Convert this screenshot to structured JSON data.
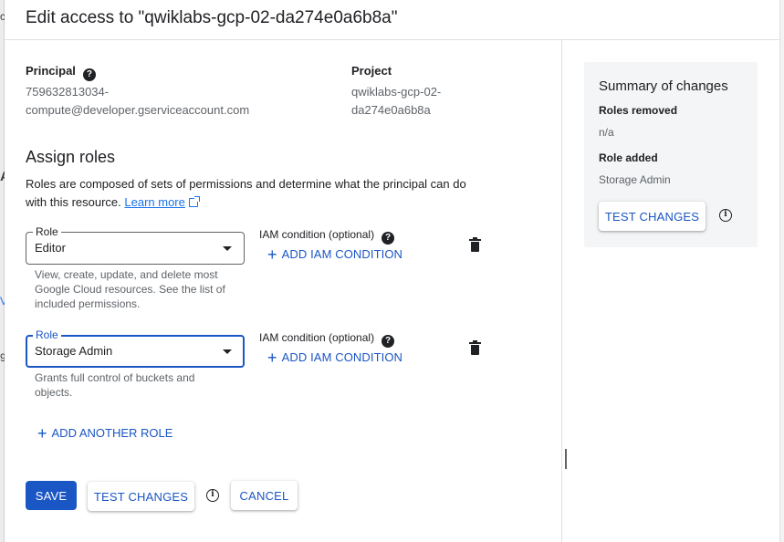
{
  "background": {
    "fragments": [
      "c",
      "A",
      "V",
      "9"
    ]
  },
  "header": {
    "title": "Edit access to \"qwiklabs-gcp-02-da274e0a6b8a\""
  },
  "principal": {
    "label": "Principal",
    "value_line1": "759632813034-",
    "value_line2": "compute@developer.gserviceaccount.com"
  },
  "project": {
    "label": "Project",
    "value_line1": "qwiklabs-gcp-02-",
    "value_line2": "da274e0a6b8a"
  },
  "assign_roles": {
    "title": "Assign roles",
    "description": "Roles are composed of sets of permissions and determine what the principal can do with this resource.",
    "learn_more": "Learn more"
  },
  "roles": [
    {
      "field_label": "Role",
      "value": "Editor",
      "hint": "View, create, update, and delete most Google Cloud resources. See the list of included permissions.",
      "iam_label": "IAM condition (optional)",
      "iam_button": "ADD IAM CONDITION"
    },
    {
      "field_label": "Role",
      "value": "Storage Admin",
      "hint": "Grants full control of buckets and objects.",
      "iam_label": "IAM condition (optional)",
      "iam_button": "ADD IAM CONDITION"
    }
  ],
  "add_another_role": "ADD ANOTHER ROLE",
  "footer": {
    "save": "SAVE",
    "test_changes": "TEST CHANGES",
    "cancel": "CANCEL"
  },
  "summary": {
    "title": "Summary of changes",
    "roles_removed_label": "Roles removed",
    "roles_removed_value": "n/a",
    "role_added_label": "Role added",
    "role_added_value": "Storage Admin",
    "test_changes": "TEST CHANGES"
  },
  "colors": {
    "accent": "#1a56c4",
    "text": "#202124",
    "muted": "#5f6368"
  }
}
